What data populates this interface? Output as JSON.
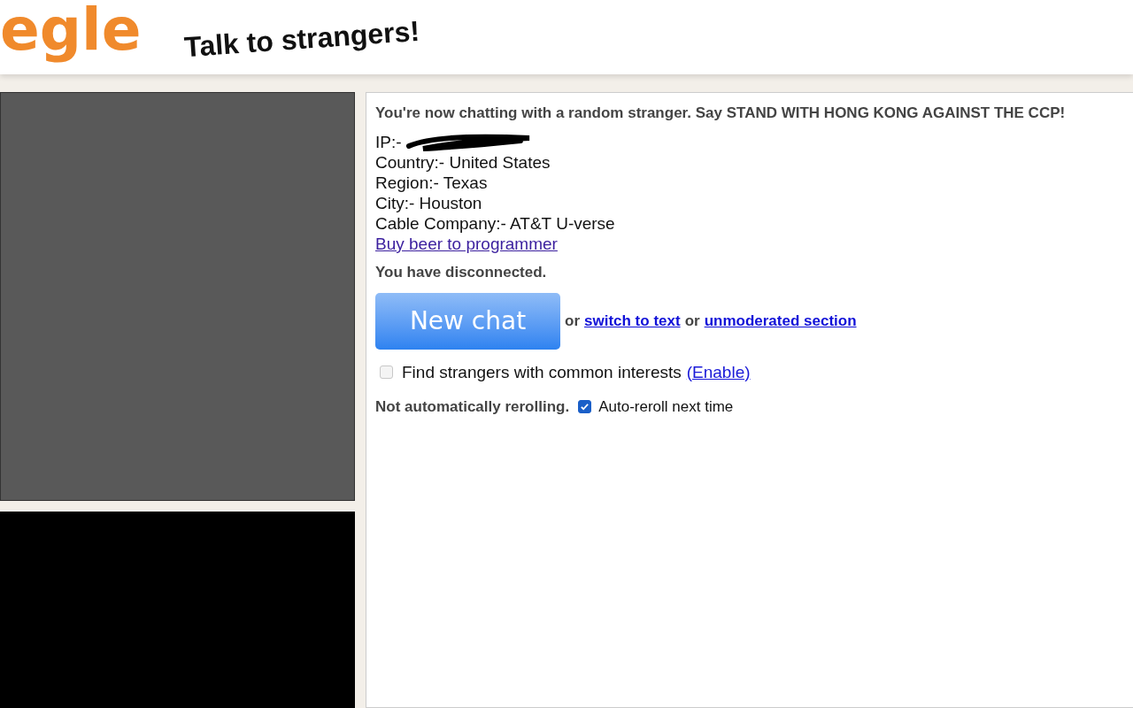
{
  "header": {
    "logo": "egle",
    "tagline": "Talk to strangers!"
  },
  "chat": {
    "intro": "You're now chatting with a random stranger. Say STAND WITH HONG KONG AGAINST THE CCP!",
    "ip_label": "IP:-",
    "info_lines": [
      "Country:- United States",
      "Region:- Texas",
      "City:- Houston",
      "Cable Company:- AT&T U-verse"
    ],
    "beer_link": "Buy beer to programmer",
    "status": "You have disconnected.",
    "new_chat_button": "New chat",
    "or_1": "or",
    "switch_link": "switch to text",
    "or_2": "or",
    "unmoderated_link": "unmoderated section",
    "interests": {
      "label": "Find strangers with common interests",
      "checked": false,
      "enable_link": "(Enable)"
    },
    "reroll_status": "Not automatically rerolling.",
    "auto_reroll": {
      "label": "Auto-reroll next time",
      "checked": true
    }
  }
}
